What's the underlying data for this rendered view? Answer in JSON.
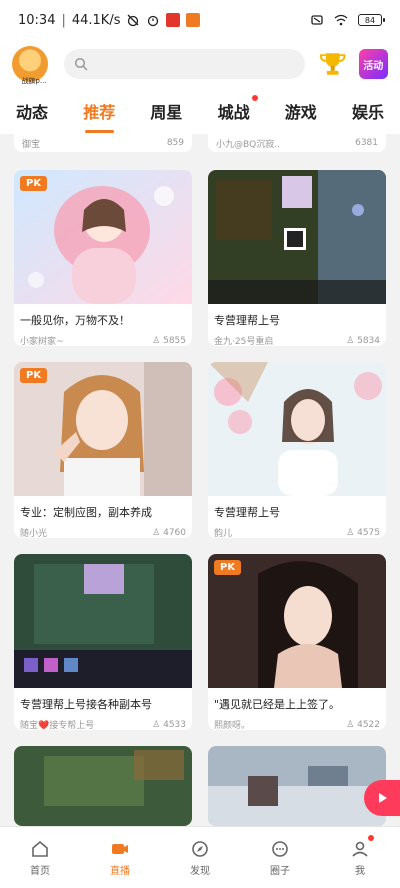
{
  "status": {
    "time": "10:34",
    "speed": "44.1K/s",
    "battery": "84"
  },
  "header": {
    "avatar_caption": "战旗p...",
    "search_placeholder": "",
    "promo_label": "活动"
  },
  "tabs": [
    {
      "label": "动态",
      "active": false
    },
    {
      "label": "推荐",
      "active": true
    },
    {
      "label": "周星",
      "active": false
    },
    {
      "label": "城战",
      "active": false,
      "dot": true
    },
    {
      "label": "游戏",
      "active": false
    },
    {
      "label": "娱乐",
      "active": false
    }
  ],
  "partial_row": [
    {
      "name": "御宝",
      "count": "859"
    },
    {
      "name": "小九@BQ沉寂..",
      "count": "6381"
    }
  ],
  "cards": [
    {
      "pk": "PK",
      "title": "一般见你，万物不及！",
      "user": "小家树家~",
      "count": "5855"
    },
    {
      "pk": "",
      "title": "专营理帮上号",
      "user": "金九·25号重启",
      "count": "5834"
    },
    {
      "pk": "PK",
      "title": "专业：定制应图，副本养成",
      "user": "随小光",
      "count": "4760"
    },
    {
      "pk": "",
      "title": "专营理帮上号",
      "user": "韵儿",
      "count": "4575"
    },
    {
      "pk": "",
      "title": "专营理帮上号接各种副本号",
      "user": "随宝❤️接专帮上号",
      "count": "4533"
    },
    {
      "pk": "PK",
      "title": "\"遇见就已经是上上签了。",
      "user": "熙颜呀。",
      "count": "4522"
    }
  ],
  "bottom_nav": [
    {
      "label": "首页",
      "icon": "home-icon",
      "active": false
    },
    {
      "label": "直播",
      "icon": "live-icon",
      "active": true
    },
    {
      "label": "发现",
      "icon": "discover-icon",
      "active": false
    },
    {
      "label": "圈子",
      "icon": "circle-icon",
      "active": false
    },
    {
      "label": "我",
      "icon": "profile-icon",
      "active": false,
      "dot": true
    }
  ],
  "colors": {
    "accent": "#f07a22",
    "badge": "#ff3b30",
    "float": "#ff3b5c"
  }
}
